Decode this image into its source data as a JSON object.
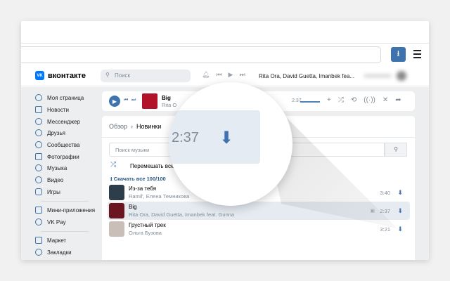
{
  "header": {
    "logo": "вконтакте",
    "search_placeholder": "Поиск",
    "now_playing": "Rita Ora, David Guetta, Imanbek fea..."
  },
  "sidebar": {
    "items": [
      {
        "label": "Моя страница"
      },
      {
        "label": "Новости"
      },
      {
        "label": "Мессенджер"
      },
      {
        "label": "Друзья"
      },
      {
        "label": "Сообщества"
      },
      {
        "label": "Фотографии"
      },
      {
        "label": "Музыка"
      },
      {
        "label": "Видео"
      },
      {
        "label": "Игры"
      },
      {
        "label": "Мини-приложения"
      },
      {
        "label": "VK Pay"
      },
      {
        "label": "Маркет"
      },
      {
        "label": "Закладки"
      }
    ]
  },
  "player": {
    "title": "Big",
    "artist": "Rita O",
    "duration": "2:37"
  },
  "music": {
    "breadcrumb_root": "Обзор",
    "breadcrumb_current": "Новинки",
    "search_placeholder": "Поиск музыки",
    "shuffle": "Перемешать все",
    "download_all": "Скачать все 100/100",
    "tracks": [
      {
        "title": "Из-за тебя",
        "artist": "Ramil', Елена Темникова",
        "duration": "3:40"
      },
      {
        "title": "Big",
        "artist": "Rita Ora, David Guetta, Imanbek feat. Gunna",
        "duration": "2:37"
      },
      {
        "title": "Грустный трек",
        "artist": "Ольга Бузова",
        "duration": "3:21"
      }
    ]
  },
  "magnifier": {
    "duration": "2:37"
  }
}
